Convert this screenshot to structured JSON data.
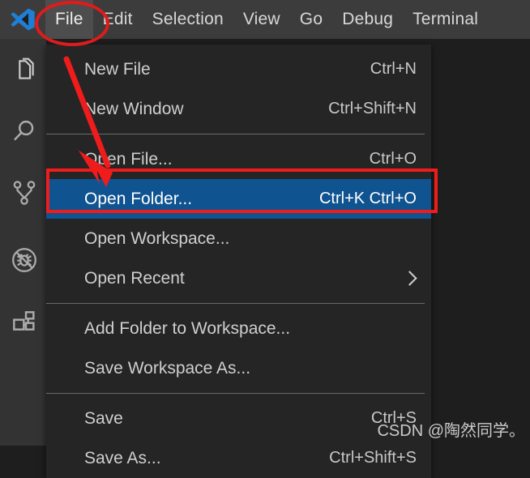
{
  "app": {
    "name": "Visual Studio Code",
    "logo_icon": "vscode-logo-icon",
    "accent_blue": "#0f5390",
    "annotation_red": "#f01c1c",
    "titlebar_bg": "#3c3c3c",
    "menu_bg": "#252526",
    "editor_bg": "#1e1e1e",
    "activitybar_bg": "#333333"
  },
  "menubar": {
    "items": [
      {
        "label": "File",
        "active": true
      },
      {
        "label": "Edit",
        "active": false
      },
      {
        "label": "Selection",
        "active": false
      },
      {
        "label": "View",
        "active": false
      },
      {
        "label": "Go",
        "active": false
      },
      {
        "label": "Debug",
        "active": false
      },
      {
        "label": "Terminal",
        "active": false
      }
    ]
  },
  "activitybar": {
    "items": [
      {
        "name": "explorer-icon",
        "title": "Explorer"
      },
      {
        "name": "search-icon",
        "title": "Search"
      },
      {
        "name": "source-control-icon",
        "title": "Source Control"
      },
      {
        "name": "debug-icon",
        "title": "Run and Debug"
      },
      {
        "name": "extensions-icon",
        "title": "Extensions"
      }
    ]
  },
  "file_menu": {
    "rows": [
      {
        "type": "item",
        "label": "New File",
        "accel": "Ctrl+N",
        "selected": false,
        "submenu": false
      },
      {
        "type": "item",
        "label": "New Window",
        "accel": "Ctrl+Shift+N",
        "selected": false,
        "submenu": false
      },
      {
        "type": "separator"
      },
      {
        "type": "item",
        "label": "Open File...",
        "accel": "Ctrl+O",
        "selected": false,
        "submenu": false
      },
      {
        "type": "item",
        "label": "Open Folder...",
        "accel": "Ctrl+K Ctrl+O",
        "selected": true,
        "submenu": false
      },
      {
        "type": "item",
        "label": "Open Workspace...",
        "accel": "",
        "selected": false,
        "submenu": false
      },
      {
        "type": "item",
        "label": "Open Recent",
        "accel": "",
        "selected": false,
        "submenu": true
      },
      {
        "type": "separator"
      },
      {
        "type": "item",
        "label": "Add Folder to Workspace...",
        "accel": "",
        "selected": false,
        "submenu": false
      },
      {
        "type": "item",
        "label": "Save Workspace As...",
        "accel": "",
        "selected": false,
        "submenu": false
      },
      {
        "type": "separator"
      },
      {
        "type": "item",
        "label": "Save",
        "accel": "Ctrl+S",
        "selected": false,
        "submenu": false
      },
      {
        "type": "item",
        "label": "Save As...",
        "accel": "Ctrl+Shift+S",
        "selected": false,
        "submenu": false
      }
    ]
  },
  "annotations": {
    "ellipse_target": "File",
    "arrow_from": "File",
    "arrow_to": "Open Folder...",
    "box_target": "Open Folder..."
  },
  "watermark": {
    "text": "CSDN @陶然同学。"
  }
}
